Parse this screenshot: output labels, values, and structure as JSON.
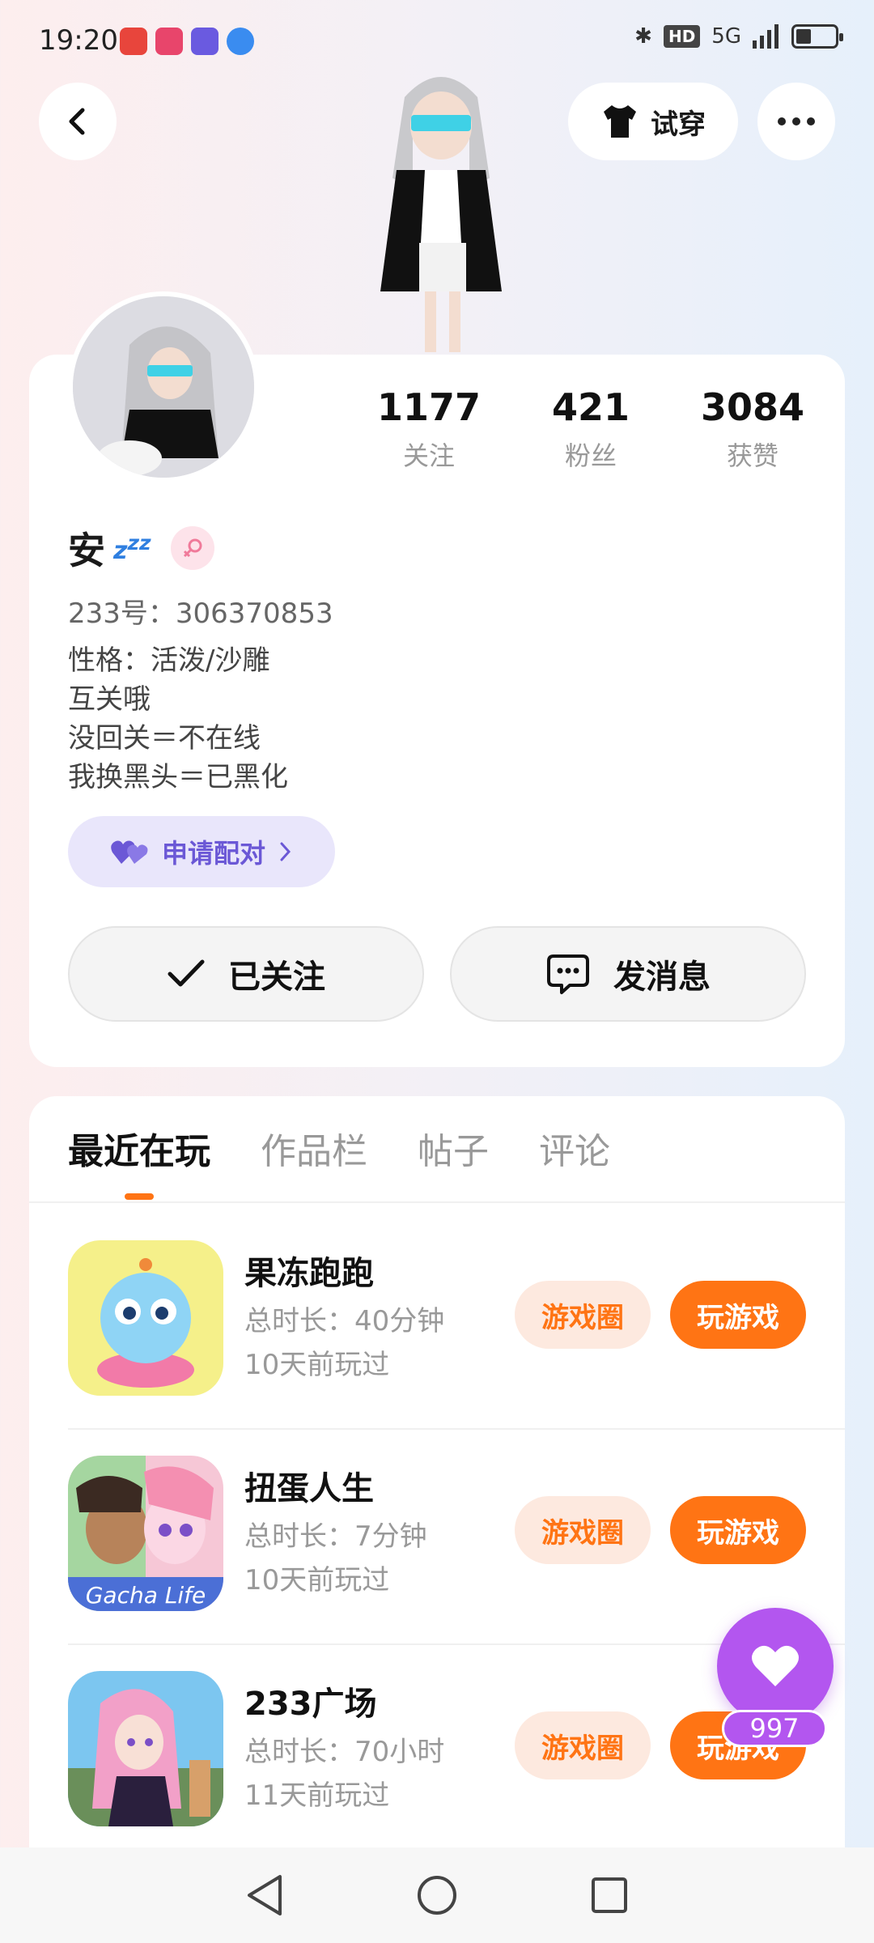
{
  "status_bar": {
    "time": "19:20",
    "network": "5G"
  },
  "header": {
    "tryon_label": "试穿"
  },
  "profile": {
    "stats": [
      {
        "value": "1177",
        "label": "关注"
      },
      {
        "value": "421",
        "label": "粉丝"
      },
      {
        "value": "3084",
        "label": "获赞"
      }
    ],
    "username": "安",
    "user_id": "233号：306370853",
    "bio": [
      "性格：活泼/沙雕",
      "互关哦",
      "没回关＝不在线",
      "我换黑头＝已黑化"
    ],
    "pair_label": "申请配对",
    "follow_label": "已关注",
    "message_label": "发消息"
  },
  "tabs": [
    {
      "label": "最近在玩",
      "active": true
    },
    {
      "label": "作品栏",
      "active": false
    },
    {
      "label": "帖子",
      "active": false
    },
    {
      "label": "评论",
      "active": false
    }
  ],
  "games": [
    {
      "name": "果冻跑跑",
      "duration": "总时长：40分钟",
      "last_played": "10天前玩过",
      "circle_label": "游戏圈",
      "play_label": "玩游戏"
    },
    {
      "name": "扭蛋人生",
      "duration": "总时长：7分钟",
      "last_played": "10天前玩过",
      "circle_label": "游戏圈",
      "play_label": "玩游戏"
    },
    {
      "name": "233广场",
      "duration": "总时长：70小时",
      "last_played": "11天前玩过",
      "circle_label": "游戏圈",
      "play_label": "玩游戏"
    }
  ],
  "like_fab": {
    "count": "997"
  },
  "colors": {
    "accent": "#ff7414",
    "like": "#b356ef",
    "pair": "#6b58d6"
  }
}
